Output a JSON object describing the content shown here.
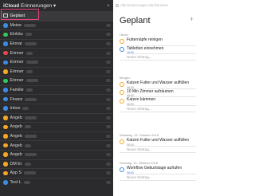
{
  "sidebar": {
    "app_name": "iCloud",
    "app_section": "Erinnerungen",
    "dropdown_arrow": "▾",
    "collapse_glyph": "+",
    "items": [
      {
        "label": "Geplant",
        "icon": "calendar-icon",
        "selected": true
      },
      {
        "label": "Meine",
        "icon_color": "#3b8ce3"
      },
      {
        "label": "Einkäu",
        "icon_color": "#34c759"
      },
      {
        "label": "Einnar",
        "icon_color": "#3b8ce3"
      },
      {
        "label": "Erinner",
        "icon_color": "#e5484d"
      },
      {
        "label": "Erinner",
        "icon_color": "#3b8ce3"
      },
      {
        "label": "Erinner",
        "icon_color": "#f5a623"
      },
      {
        "label": "Erinner",
        "icon_color": "#34c759"
      },
      {
        "label": "Familie",
        "icon_color": "#3b8ce3"
      },
      {
        "label": "Finanz",
        "icon_color": "#3b8ce3"
      },
      {
        "label": "Inbox",
        "icon_color": "#3b8ce3"
      },
      {
        "label": "Angeb",
        "icon_color": "#f5a623"
      },
      {
        "label": "Angeb",
        "icon_color": "#f5a623"
      },
      {
        "label": "Angeb",
        "icon_color": "#f5a623"
      },
      {
        "label": "Angeb",
        "icon_color": "#f5a623"
      },
      {
        "label": "Angeb",
        "icon_color": "#f5a623"
      },
      {
        "label": "DM Er",
        "icon_color": "#f5a623"
      },
      {
        "label": "App S",
        "icon_color": "#f5a623"
      },
      {
        "label": "Test L",
        "icon_color": "#3b8ce3"
      }
    ]
  },
  "main": {
    "search_placeholder": "Alle Erinnerungen durchsuchen",
    "title": "Geplant",
    "add_glyph": "+",
    "sections": [
      {
        "heading": "Heute",
        "tasks": [
          {
            "name": "Futternäpfe reinigen",
            "time": "",
            "circle": "orange"
          },
          {
            "name": "Tabletten einnehmen",
            "time": "18:00",
            "circle": "blue"
          }
        ],
        "new_entry": "Neuer Eintrag..."
      },
      {
        "heading": "Morgen",
        "tasks": [
          {
            "name": "Katzen Futter und Wasser auffüllen",
            "time": "06:00",
            "circle": "orange"
          },
          {
            "name": "10 Min Zimmer aufräumen",
            "time": "06:00",
            "circle": "orange"
          },
          {
            "name": "Katzen kämmen",
            "time": "06:00",
            "circle": "orange"
          }
        ],
        "new_entry": "Neuer Eintrag..."
      },
      {
        "heading": "Samstag, 13. Oktober 2018",
        "tasks": [
          {
            "name": "Katzen Futter und Wasser auffüllen",
            "time": "06:00",
            "circle": "orange"
          }
        ],
        "new_entry": "Neuer Eintrag..."
      },
      {
        "heading": "Sonntag, 14. Oktober 2018",
        "tasks": [
          {
            "name": "Workflow Geburtstage aufrufen",
            "time": "06:00",
            "circle": "blue"
          }
        ],
        "new_entry": "Neuer Eintrag..."
      }
    ]
  }
}
